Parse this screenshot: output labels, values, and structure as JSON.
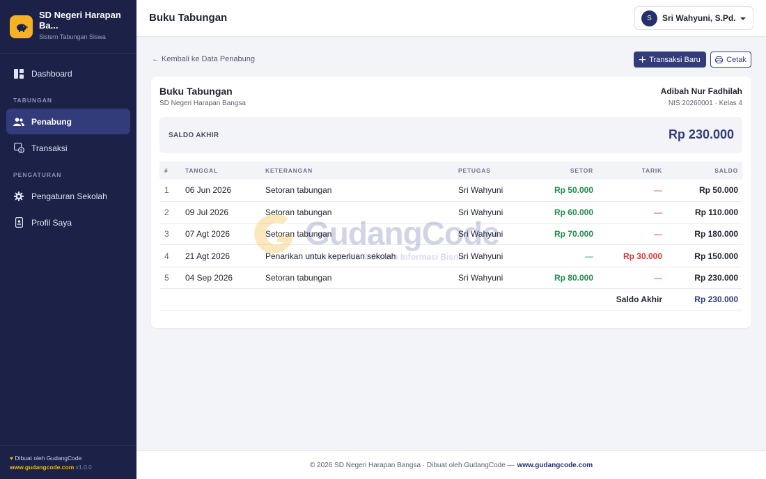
{
  "sidebar": {
    "brand_title": "SD Negeri Harapan Ba...",
    "brand_subtitle": "Sistem Tabungan Siswa",
    "dashboard_label": "Dashboard",
    "section_tabungan": "TABUNGAN",
    "penabung_label": "Penabung",
    "transaksi_label": "Transaksi",
    "section_pengaturan": "PENGATURAN",
    "pengaturan_sekolah_label": "Pengaturan Sekolah",
    "profil_label": "Profil Saya",
    "footer_made_by": "Dibuat oleh GudangCode",
    "footer_link": "www.gudangcode.com",
    "footer_version": "v1.0.0"
  },
  "topbar": {
    "title": "Buku Tabungan",
    "user_initial": "S",
    "user_name": "Sri Wahyuni, S.Pd."
  },
  "actions": {
    "back_label": "← Kembali ke Data Penabung",
    "new_transaction": "Transaksi Baru",
    "print": "Cetak"
  },
  "card": {
    "title": "Buku Tabungan",
    "school": "SD Negeri Harapan Bangsa",
    "student_name": "Adibah Nur Fadhilah",
    "student_info": "NIS 20260001 · Kelas 4",
    "saldo_label": "SALDO AKHIR",
    "saldo_value": "Rp 230.000"
  },
  "table": {
    "headers": [
      "#",
      "TANGGAL",
      "KETERANGAN",
      "PETUGAS",
      "SETOR",
      "TARIK",
      "SALDO"
    ],
    "rows": [
      {
        "no": "1",
        "date": "06 Jun 2026",
        "ket": "Setoran tabungan",
        "petugas": "Sri Wahyuni",
        "setor": "Rp 50.000",
        "tarik": "—",
        "saldo": "Rp 50.000"
      },
      {
        "no": "2",
        "date": "09 Jul 2026",
        "ket": "Setoran tabungan",
        "petugas": "Sri Wahyuni",
        "setor": "Rp 60.000",
        "tarik": "—",
        "saldo": "Rp 110.000"
      },
      {
        "no": "3",
        "date": "07 Agt 2026",
        "ket": "Setoran tabungan",
        "petugas": "Sri Wahyuni",
        "setor": "Rp 70.000",
        "tarik": "—",
        "saldo": "Rp 180.000"
      },
      {
        "no": "4",
        "date": "21 Agt 2026",
        "ket": "Penarikan untuk keperluan sekolah",
        "petugas": "Sri Wahyuni",
        "setor": "—",
        "tarik": "Rp 30.000",
        "saldo": "Rp 150.000"
      },
      {
        "no": "5",
        "date": "04 Sep 2026",
        "ket": "Setoran tabungan",
        "petugas": "Sri Wahyuni",
        "setor": "Rp 80.000",
        "tarik": "—",
        "saldo": "Rp 230.000"
      }
    ],
    "total_label": "Saldo Akhir",
    "total_value": "Rp 230.000"
  },
  "watermark": {
    "text": "GudangCode",
    "subtitle": "Source Code & Sistem Informasi Bisnis"
  },
  "footer": {
    "text": "© 2026 SD Negeri Harapan Bangsa · Dibuat oleh GudangCode —",
    "link": "www.gudangcode.com"
  },
  "colors": {
    "sidebar_bg": "#1b2147",
    "accent": "#323c7a",
    "brand_yellow": "#f5b324",
    "setor_green": "#1f8a4c",
    "tarik_red": "#d13a3a"
  }
}
